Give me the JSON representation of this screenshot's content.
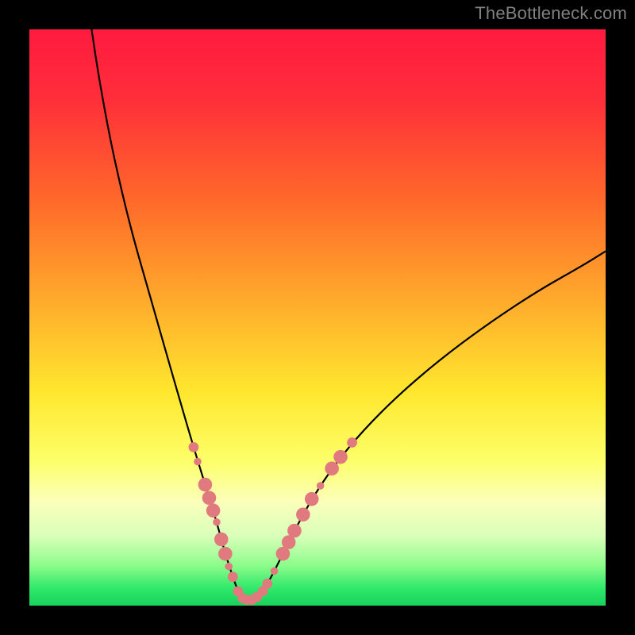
{
  "watermark": "TheBottleneck.com",
  "chart_data": {
    "type": "line",
    "title": "",
    "xlabel": "",
    "ylabel": "",
    "xlim": [
      0,
      100
    ],
    "ylim": [
      0,
      100
    ],
    "gradient_stops": [
      {
        "offset": 0,
        "color": "#ff1a3f"
      },
      {
        "offset": 12,
        "color": "#ff2e3a"
      },
      {
        "offset": 30,
        "color": "#ff6a2a"
      },
      {
        "offset": 48,
        "color": "#ffae2c"
      },
      {
        "offset": 63,
        "color": "#ffe72e"
      },
      {
        "offset": 75,
        "color": "#fdff6a"
      },
      {
        "offset": 82,
        "color": "#fbffba"
      },
      {
        "offset": 88,
        "color": "#d8ffb9"
      },
      {
        "offset": 93,
        "color": "#8dfc8b"
      },
      {
        "offset": 97,
        "color": "#2fe96a"
      },
      {
        "offset": 100,
        "color": "#18d25c"
      }
    ],
    "series": [
      {
        "name": "bottleneck-curve",
        "x": [
          10.8,
          12,
          14,
          16,
          18,
          20,
          22,
          24,
          26,
          28.5,
          30.5,
          32.5,
          34,
          35.3,
          36.2,
          37.5,
          39,
          40.5,
          42,
          44,
          46,
          49,
          53,
          58,
          64,
          71,
          79,
          88,
          96,
          100
        ],
        "y": [
          100,
          92,
          81,
          72,
          64,
          57,
          50,
          43,
          36,
          27.5,
          21,
          14.5,
          9,
          5,
          2.5,
          1,
          1,
          2.5,
          5,
          9,
          13,
          18.5,
          24.5,
          30.5,
          36.5,
          42.5,
          48.5,
          54.5,
          59,
          61.5
        ]
      }
    ],
    "markers": {
      "name": "highlight-dots",
      "color": "#e17a7e",
      "points": [
        {
          "x": 28.5,
          "y": 27.5,
          "r": 1.6
        },
        {
          "x": 29.2,
          "y": 25.0,
          "r": 1.2
        },
        {
          "x": 30.5,
          "y": 21.0,
          "r": 2.2
        },
        {
          "x": 31.2,
          "y": 18.7,
          "r": 2.2
        },
        {
          "x": 31.9,
          "y": 16.5,
          "r": 2.2
        },
        {
          "x": 32.5,
          "y": 14.5,
          "r": 1.2
        },
        {
          "x": 33.3,
          "y": 11.5,
          "r": 2.2
        },
        {
          "x": 34.0,
          "y": 9.0,
          "r": 2.2
        },
        {
          "x": 34.6,
          "y": 6.8,
          "r": 1.2
        },
        {
          "x": 35.3,
          "y": 5.0,
          "r": 1.6
        },
        {
          "x": 36.2,
          "y": 2.5,
          "r": 1.6
        },
        {
          "x": 37.0,
          "y": 1.3,
          "r": 1.6
        },
        {
          "x": 37.8,
          "y": 1.0,
          "r": 1.6
        },
        {
          "x": 38.6,
          "y": 1.0,
          "r": 1.6
        },
        {
          "x": 39.5,
          "y": 1.5,
          "r": 1.6
        },
        {
          "x": 40.5,
          "y": 2.5,
          "r": 1.6
        },
        {
          "x": 41.3,
          "y": 3.8,
          "r": 1.6
        },
        {
          "x": 42.5,
          "y": 6.0,
          "r": 1.2
        },
        {
          "x": 44.0,
          "y": 9.0,
          "r": 2.2
        },
        {
          "x": 45.0,
          "y": 11.0,
          "r": 2.2
        },
        {
          "x": 46.0,
          "y": 13.0,
          "r": 2.2
        },
        {
          "x": 47.5,
          "y": 15.8,
          "r": 2.2
        },
        {
          "x": 49.0,
          "y": 18.5,
          "r": 2.2
        },
        {
          "x": 50.5,
          "y": 20.8,
          "r": 1.2
        },
        {
          "x": 52.5,
          "y": 23.8,
          "r": 2.2
        },
        {
          "x": 54.0,
          "y": 25.8,
          "r": 2.2
        },
        {
          "x": 56.0,
          "y": 28.3,
          "r": 1.6
        }
      ]
    }
  }
}
